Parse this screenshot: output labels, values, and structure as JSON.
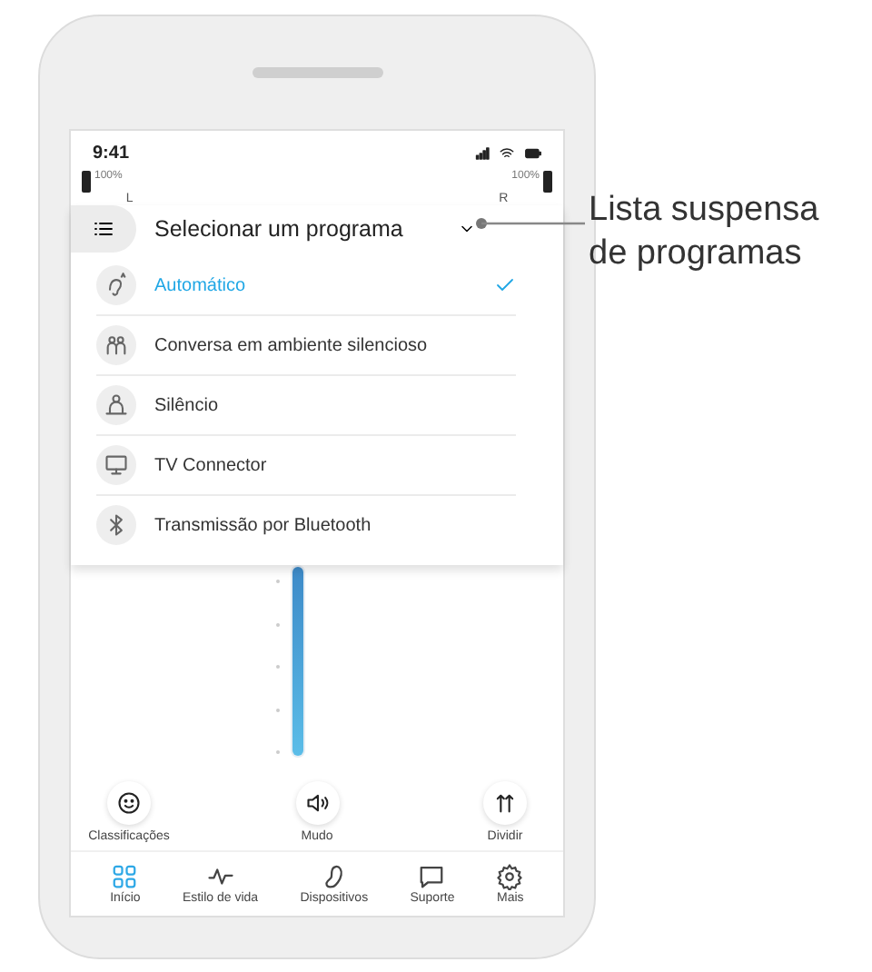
{
  "status_bar": {
    "time": "9:41"
  },
  "hearing_aids": [
    {
      "side": "L",
      "battery": "100%"
    },
    {
      "side": "R",
      "battery": "100%"
    }
  ],
  "program_dropdown": {
    "title": "Selecionar um programa",
    "expanded": true,
    "programs": [
      {
        "label": "Automático",
        "kind": "automatic",
        "selected": true
      },
      {
        "label": "Conversa em ambiente silencioso",
        "kind": "conversation",
        "selected": false
      },
      {
        "label": "Silêncio",
        "kind": "quiet",
        "selected": false
      },
      {
        "label": "TV Connector",
        "kind": "tv",
        "selected": false
      },
      {
        "label": "Transmissão por Bluetooth",
        "kind": "bluetooth",
        "selected": false
      }
    ]
  },
  "volume": {
    "level": 1
  },
  "actions": [
    {
      "label": "Classificações",
      "kind": "rate"
    },
    {
      "label": "Mudo",
      "kind": "mute"
    },
    {
      "label": "Dividir",
      "kind": "split"
    }
  ],
  "tabs": [
    {
      "label": "Início",
      "kind": "home",
      "selected": true
    },
    {
      "label": "Estilo de vida",
      "kind": "lifestyle",
      "selected": false
    },
    {
      "label": "Dispositivos",
      "kind": "devices",
      "selected": false
    },
    {
      "label": "Suporte",
      "kind": "support",
      "selected": false
    },
    {
      "label": "Mais",
      "kind": "more",
      "selected": false
    }
  ],
  "annotation": {
    "text": "Lista suspensa de programas"
  }
}
